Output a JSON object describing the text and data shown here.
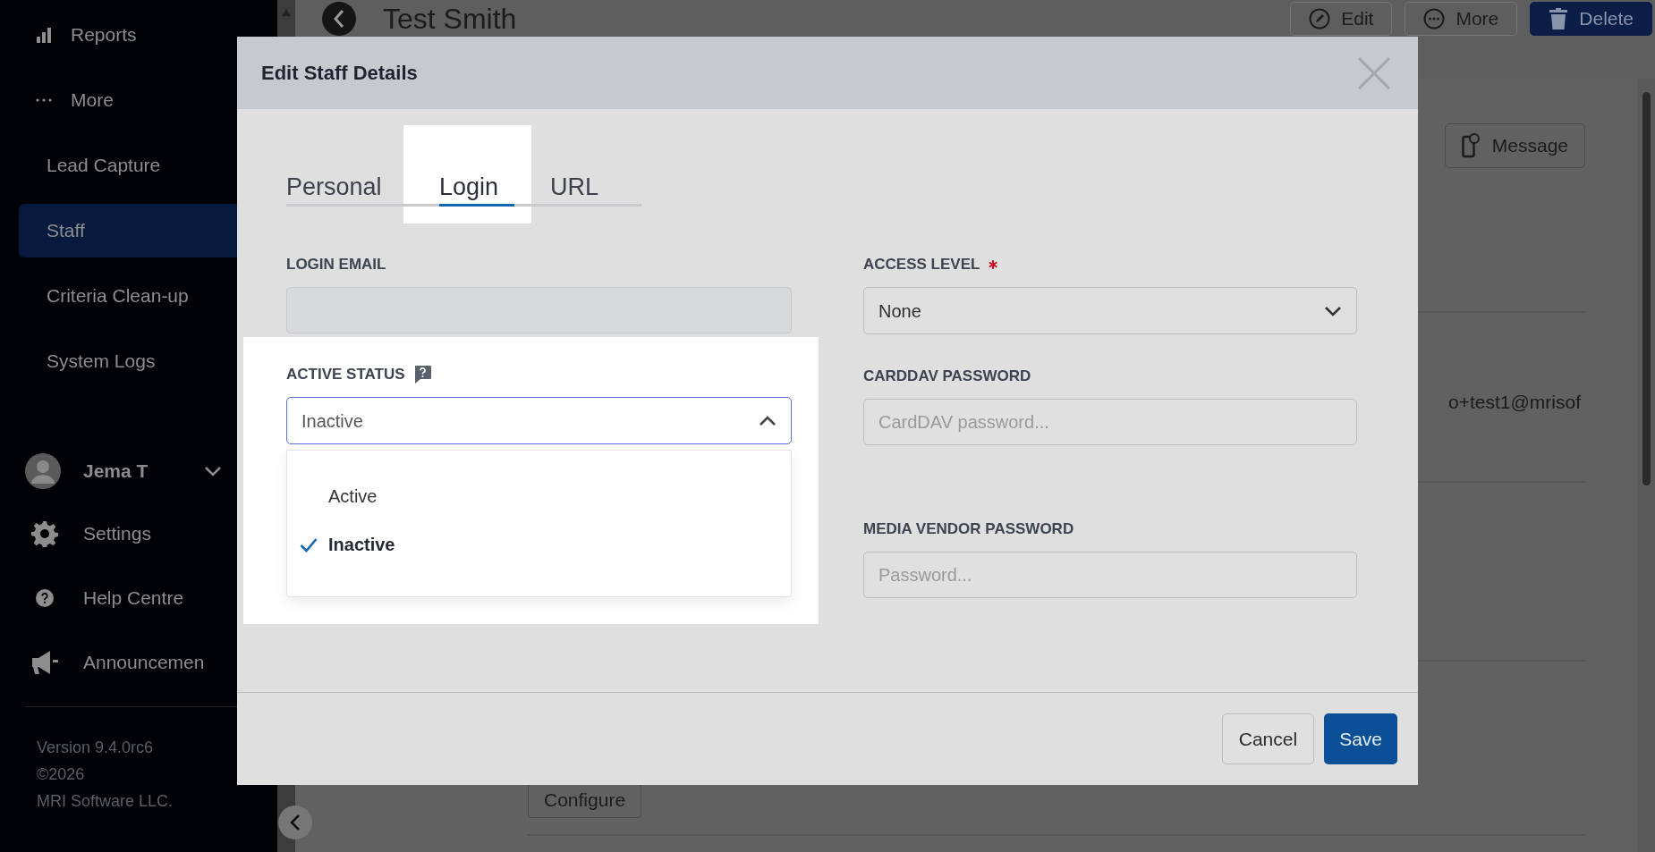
{
  "sidebar": {
    "items": [
      {
        "label": "Reports",
        "kind": "main",
        "selected": false
      },
      {
        "label": "More",
        "kind": "main",
        "selected": false
      },
      {
        "label": "Lead Capture",
        "kind": "sub",
        "selected": false
      },
      {
        "label": "Staff",
        "kind": "sub",
        "selected": true
      },
      {
        "label": "Criteria Clean-up",
        "kind": "sub",
        "selected": false
      },
      {
        "label": "System Logs",
        "kind": "sub",
        "selected": false
      }
    ],
    "user": {
      "name": "Jema T"
    },
    "bottom_items": [
      {
        "label": "Settings"
      },
      {
        "label": "Help Centre"
      },
      {
        "label": "Announcemen"
      }
    ],
    "footer": [
      "Version 9.4.0rc6",
      "©2026",
      "MRI Software LLC."
    ]
  },
  "page": {
    "title": "Test Smith",
    "buttons": [
      {
        "label": "Edit",
        "kind": "outline"
      },
      {
        "label": "More",
        "kind": "outline"
      },
      {
        "label": "Delete",
        "kind": "danger"
      }
    ],
    "message_button": "Message",
    "email_fragment": "o+test1@mrisof",
    "configure_button": "Configure"
  },
  "modal": {
    "title": "Edit Staff Details",
    "tabs": [
      {
        "label": "Personal",
        "selected": false,
        "highlighted": false
      },
      {
        "label": "Login",
        "selected": true,
        "highlighted": true
      },
      {
        "label": "URL",
        "selected": false,
        "highlighted": false
      }
    ],
    "left_fields": [
      {
        "label": "LOGIN EMAIL",
        "kind": "input",
        "disabled": true,
        "required": false,
        "help": false,
        "highlighted": false
      },
      {
        "label": "ACTIVE STATUS",
        "kind": "select",
        "value": "Inactive",
        "expanded": true,
        "required": false,
        "help": true,
        "highlighted": true,
        "options": [
          {
            "label": "Active",
            "selected": false
          },
          {
            "label": "Inactive",
            "selected": true
          }
        ]
      }
    ],
    "right_fields": [
      {
        "label": "ACCESS LEVEL",
        "kind": "select",
        "value": "None",
        "expanded": false,
        "required": true,
        "help": false,
        "highlighted": false
      },
      {
        "label": "CARDDAV PASSWORD",
        "kind": "input",
        "placeholder": "CardDAV password...",
        "disabled": false,
        "required": false,
        "help": false,
        "highlighted": false
      },
      {
        "label": "MEDIA VENDOR PASSWORD",
        "kind": "input",
        "placeholder": "Password...",
        "disabled": false,
        "required": false,
        "help": false,
        "highlighted": false
      }
    ],
    "buttons": [
      {
        "label": "Cancel",
        "kind": "secondary"
      },
      {
        "label": "Save",
        "kind": "primary"
      }
    ]
  }
}
